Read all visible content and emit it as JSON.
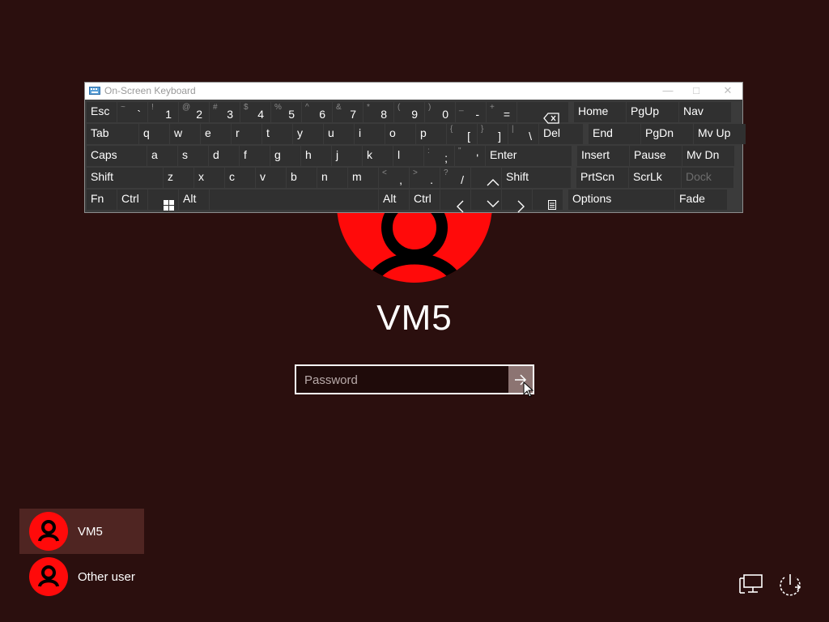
{
  "login": {
    "username": "VM5",
    "password_placeholder": "Password"
  },
  "users": [
    {
      "name": "VM5",
      "selected": true
    },
    {
      "name": "Other user",
      "selected": false
    }
  ],
  "corner_icons": [
    "network-icon",
    "power-icon"
  ],
  "osk": {
    "title": "On-Screen Keyboard",
    "rows": [
      [
        {
          "id": "esc",
          "label": "Esc"
        },
        {
          "id": "tilde",
          "shift": "~",
          "base": "`"
        },
        {
          "id": "1",
          "shift": "!",
          "base": "1"
        },
        {
          "id": "2",
          "shift": "@",
          "base": "2"
        },
        {
          "id": "3",
          "shift": "#",
          "base": "3"
        },
        {
          "id": "4",
          "shift": "$",
          "base": "4"
        },
        {
          "id": "5",
          "shift": "%",
          "base": "5"
        },
        {
          "id": "6",
          "shift": "^",
          "base": "6"
        },
        {
          "id": "7",
          "shift": "&",
          "base": "7"
        },
        {
          "id": "8",
          "shift": "*",
          "base": "8"
        },
        {
          "id": "9",
          "shift": "(",
          "base": "9"
        },
        {
          "id": "0",
          "shift": ")",
          "base": "0"
        },
        {
          "id": "minus",
          "shift": "_",
          "base": "-"
        },
        {
          "id": "equals",
          "shift": "+",
          "base": "="
        },
        {
          "id": "backspace",
          "icon": "backspace-icon"
        },
        {
          "id": "home",
          "label": "Home"
        },
        {
          "id": "pgup",
          "label": "PgUp"
        },
        {
          "id": "nav",
          "label": "Nav"
        }
      ],
      [
        {
          "id": "tab",
          "label": "Tab"
        },
        {
          "id": "q",
          "label": "q"
        },
        {
          "id": "w",
          "label": "w"
        },
        {
          "id": "e",
          "label": "e"
        },
        {
          "id": "r",
          "label": "r"
        },
        {
          "id": "t",
          "label": "t"
        },
        {
          "id": "y",
          "label": "y"
        },
        {
          "id": "u",
          "label": "u"
        },
        {
          "id": "i",
          "label": "i"
        },
        {
          "id": "o",
          "label": "o"
        },
        {
          "id": "p",
          "label": "p"
        },
        {
          "id": "lbracket",
          "shift": "{",
          "base": "["
        },
        {
          "id": "rbracket",
          "shift": "}",
          "base": "]"
        },
        {
          "id": "backslash",
          "shift": "|",
          "base": "\\"
        },
        {
          "id": "del",
          "label": "Del"
        },
        {
          "id": "end",
          "label": "End"
        },
        {
          "id": "pgdn",
          "label": "PgDn"
        },
        {
          "id": "mvup",
          "label": "Mv Up"
        }
      ],
      [
        {
          "id": "caps",
          "label": "Caps"
        },
        {
          "id": "a",
          "label": "a"
        },
        {
          "id": "s",
          "label": "s"
        },
        {
          "id": "d",
          "label": "d"
        },
        {
          "id": "f",
          "label": "f"
        },
        {
          "id": "g",
          "label": "g"
        },
        {
          "id": "h",
          "label": "h"
        },
        {
          "id": "j",
          "label": "j"
        },
        {
          "id": "k",
          "label": "k"
        },
        {
          "id": "l",
          "label": "l"
        },
        {
          "id": "semicolon",
          "shift": ":",
          "base": ";"
        },
        {
          "id": "quote",
          "shift": "\"",
          "base": "'"
        },
        {
          "id": "enter",
          "label": "Enter"
        },
        {
          "id": "insert",
          "label": "Insert"
        },
        {
          "id": "pause",
          "label": "Pause"
        },
        {
          "id": "mvdn",
          "label": "Mv Dn"
        }
      ],
      [
        {
          "id": "lshift",
          "label": "Shift"
        },
        {
          "id": "z",
          "label": "z"
        },
        {
          "id": "x",
          "label": "x"
        },
        {
          "id": "c",
          "label": "c"
        },
        {
          "id": "v",
          "label": "v"
        },
        {
          "id": "b",
          "label": "b"
        },
        {
          "id": "n",
          "label": "n"
        },
        {
          "id": "m",
          "label": "m"
        },
        {
          "id": "comma",
          "shift": "<",
          "base": ","
        },
        {
          "id": "period",
          "shift": ">",
          "base": "."
        },
        {
          "id": "slash",
          "shift": "?",
          "base": "/"
        },
        {
          "id": "up",
          "icon": "arrow-up-icon"
        },
        {
          "id": "rshift",
          "label": "Shift"
        },
        {
          "id": "prtscn",
          "label": "PrtScn"
        },
        {
          "id": "scrlk",
          "label": "ScrLk"
        },
        {
          "id": "dock",
          "label": "Dock",
          "disabled": true
        }
      ],
      [
        {
          "id": "fn",
          "label": "Fn"
        },
        {
          "id": "lctrl",
          "label": "Ctrl"
        },
        {
          "id": "win",
          "icon": "windows-icon"
        },
        {
          "id": "lalt",
          "label": "Alt"
        },
        {
          "id": "space",
          "label": ""
        },
        {
          "id": "ralt",
          "label": "Alt"
        },
        {
          "id": "rctrl",
          "label": "Ctrl"
        },
        {
          "id": "left",
          "icon": "arrow-left-icon"
        },
        {
          "id": "down",
          "icon": "arrow-down-icon"
        },
        {
          "id": "right",
          "icon": "arrow-right-icon"
        },
        {
          "id": "menu",
          "icon": "menu-icon"
        },
        {
          "id": "options",
          "label": "Options"
        },
        {
          "id": "fade",
          "label": "Fade"
        }
      ]
    ]
  },
  "colors": {
    "background": "#2b0f0e",
    "avatar": "#ff0a0a",
    "selected_user": "#4f2522",
    "key": "#303030",
    "keyboard_frame": "#3b3b3b"
  }
}
